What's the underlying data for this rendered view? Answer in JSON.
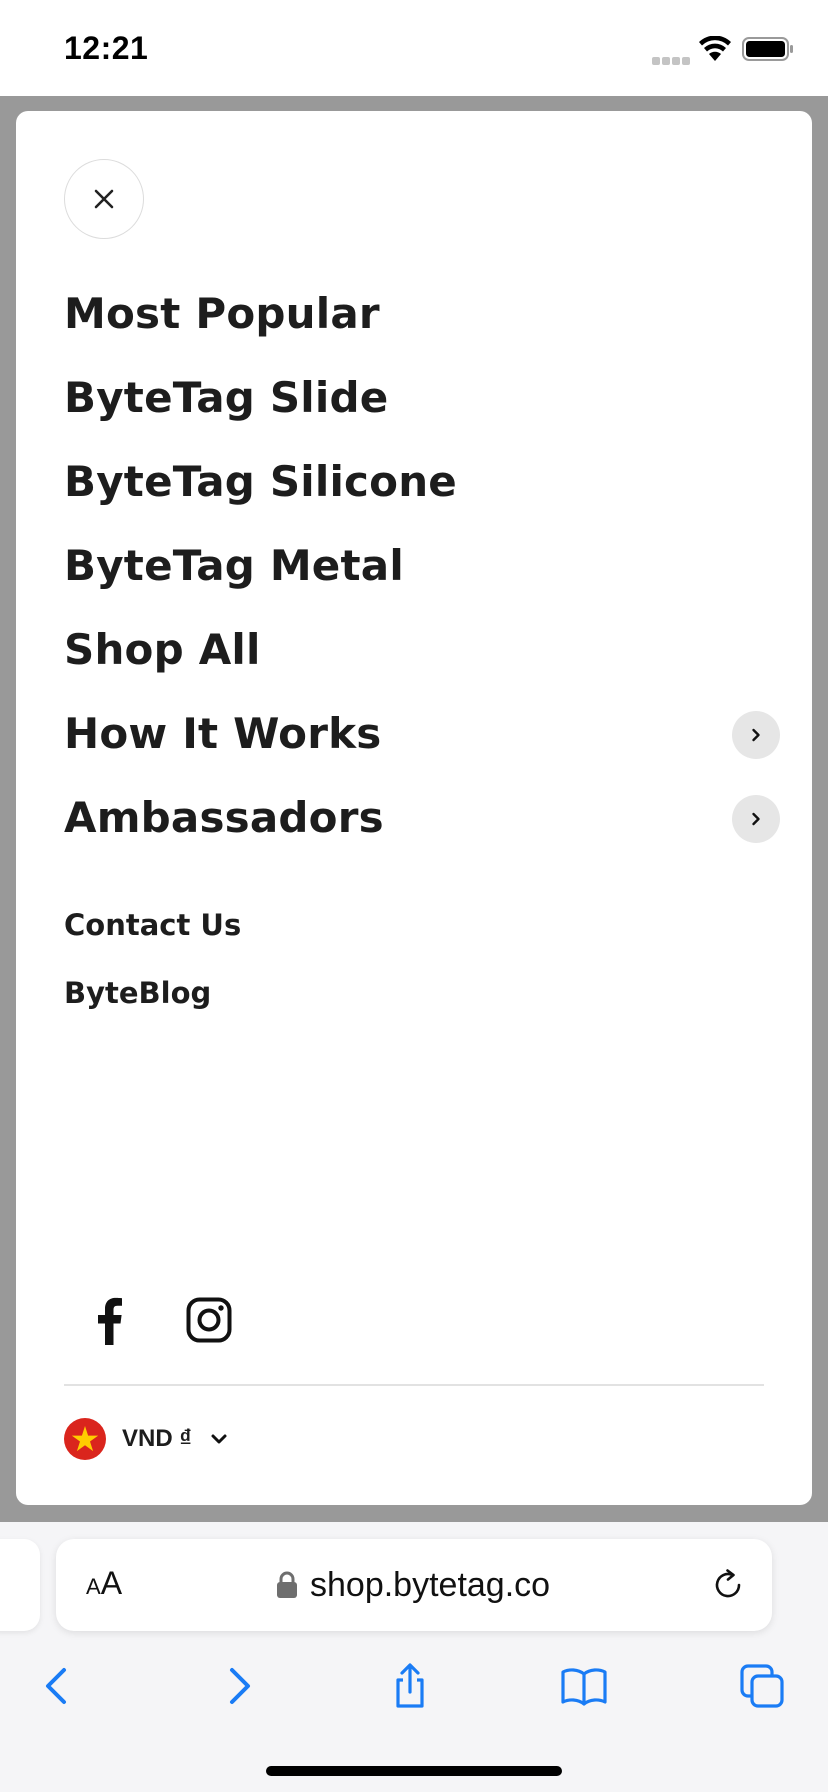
{
  "status_bar": {
    "time": "12:21"
  },
  "drawer": {
    "main_nav": [
      {
        "label": "Most Popular",
        "has_submenu": false
      },
      {
        "label": "ByteTag Slide",
        "has_submenu": false
      },
      {
        "label": "ByteTag Silicone",
        "has_submenu": false
      },
      {
        "label": "ByteTag Metal",
        "has_submenu": false
      },
      {
        "label": "Shop All",
        "has_submenu": false
      },
      {
        "label": "How It Works",
        "has_submenu": true
      },
      {
        "label": "Ambassadors",
        "has_submenu": true
      }
    ],
    "secondary_nav": [
      {
        "label": "Contact Us"
      },
      {
        "label": "ByteBlog"
      }
    ],
    "social_icons": [
      "facebook-icon",
      "instagram-icon"
    ],
    "currency": {
      "label": "VND ₫",
      "flag": "vietnam-flag-icon"
    }
  },
  "browser": {
    "aa_small": "A",
    "aa_large": "A",
    "url": "shop.bytetag.co",
    "toolbar_icons": [
      "back-icon",
      "forward-icon",
      "share-icon",
      "bookmarks-icon",
      "tabs-icon"
    ]
  },
  "colors": {
    "overlay": "#999999",
    "accent": "#1a7cf5",
    "text": "#1d1d1d",
    "flag_red": "#da251d",
    "flag_star": "#ffcd00"
  }
}
